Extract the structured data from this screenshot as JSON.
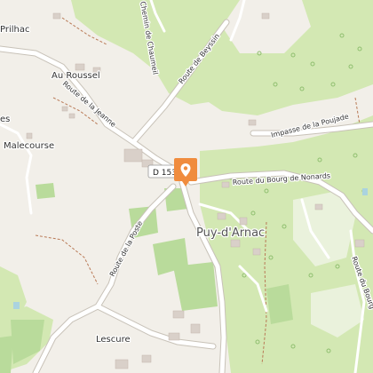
{
  "map": {
    "places": {
      "prilhac": "Prilhac",
      "au_roussel": "Au Roussel",
      "malecourse": "Malecourse",
      "puy_darnac": "Puy-d'Arnac",
      "lescure": "Lescure"
    },
    "partial_text": {
      "left_fragment": "es"
    },
    "roads": {
      "route_de_beyssin": "Route de Beyssin",
      "route_de_la_jeanne": "Route de la Jeanne",
      "route_du_bourg": "Route du Bourg de Nonards",
      "impasse_poujade": "Impasse de la Poujade",
      "route_de_la_poste": "Route de la Poste",
      "chemin_top": "Chemin de Chaumeil",
      "route_bourg_right": "Route du Bourg"
    },
    "shield": "D 153",
    "marker_icon": "map-pin-icon",
    "colors": {
      "background": "#f2efe9",
      "forest": "#d3e8b3",
      "meadow": "#b9db9b",
      "orchard": "#add19e",
      "road": "#ffffff",
      "marker": "#f08c3e"
    }
  }
}
